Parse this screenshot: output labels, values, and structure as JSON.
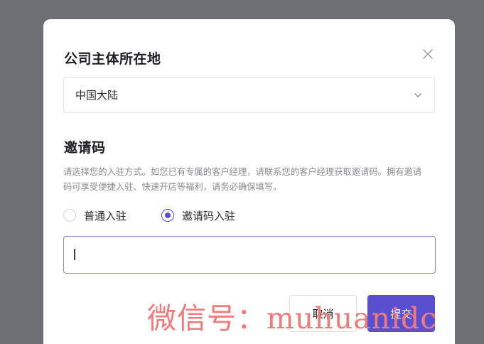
{
  "dialog": {
    "region_title": "公司主体所在地",
    "region_value": "中国大陆",
    "invite_title": "邀请码",
    "description": "请选择您的入驻方式。如您已有专属的客户经理，请联系您的客户经理获取邀请码。拥有邀请码可享受便捷入驻、快速开店等福利，请务必确保填写。",
    "options": [
      {
        "label": "普通入驻",
        "checked": false
      },
      {
        "label": "邀请码入驻",
        "checked": true
      }
    ],
    "invite_input_value": "",
    "cancel_label": "取消",
    "submit_label": "提交"
  },
  "watermark": "微信号：muhuanidc",
  "colors": {
    "accent": "#5a4fcf",
    "overlay": "#6e6f74",
    "watermark": "#f07b7b"
  },
  "icons": {
    "close": "close-icon",
    "dropdown": "chevron-down-icon",
    "radio": "radio-icon"
  }
}
